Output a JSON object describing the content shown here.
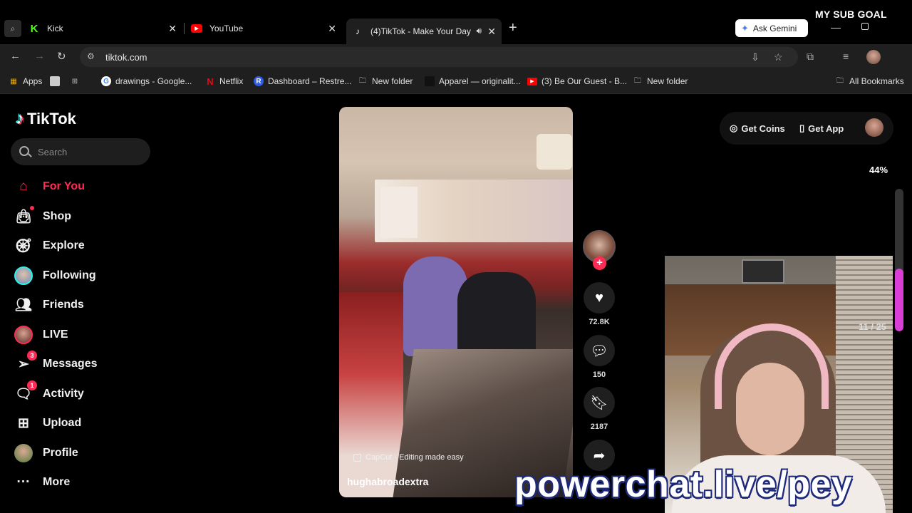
{
  "overlay": {
    "sub_goal": "MY SUB GOAL",
    "sub_goal_percent": "44%",
    "sub_goal_fraction": 0.44,
    "counter": "11 / 25",
    "powerchat": "powerchat.live/pey"
  },
  "browser": {
    "tabs": [
      {
        "label": "Kick",
        "icon": "kick-icon",
        "color": "#53fc18"
      },
      {
        "label": "YouTube",
        "icon": "youtube-icon",
        "color": "#ff0000"
      },
      {
        "label": "(4)TikTok - Make Your Day",
        "icon": "tiktok-icon",
        "active": true
      }
    ],
    "gemini_label": "Ask Gemini",
    "url": "tiktok.com",
    "bookmarks": [
      {
        "label": "Apps",
        "icon": "apps-grid-icon"
      },
      {
        "label": "drawings - Google...",
        "icon": "google-icon"
      },
      {
        "label": "Netflix",
        "icon": "netflix-icon"
      },
      {
        "label": "Dashboard – Restre...",
        "icon": "restream-icon"
      },
      {
        "label": "New folder",
        "icon": "folder-icon"
      },
      {
        "label": "Apparel — originalit...",
        "icon": "apparel-icon"
      },
      {
        "label": "(3) Be Our Guest - B...",
        "icon": "youtube-icon"
      },
      {
        "label": "New folder",
        "icon": "folder-icon"
      },
      {
        "label": "All Bookmarks",
        "icon": "folder-icon"
      }
    ]
  },
  "tiktok": {
    "logo": "TikTok",
    "search_placeholder": "Search",
    "nav": [
      {
        "label": "For You",
        "icon": "home-icon",
        "active": true
      },
      {
        "label": "Shop",
        "icon": "shop-bag-icon"
      },
      {
        "label": "Explore",
        "icon": "compass-icon"
      },
      {
        "label": "Following",
        "icon": "following-avatar-icon"
      },
      {
        "label": "Friends",
        "icon": "friends-icon"
      },
      {
        "label": "LIVE",
        "icon": "live-avatar-icon"
      },
      {
        "label": "Messages",
        "icon": "messages-icon",
        "badge": "3"
      },
      {
        "label": "Activity",
        "icon": "activity-icon",
        "badge": "1"
      },
      {
        "label": "Upload",
        "icon": "upload-icon"
      },
      {
        "label": "Profile",
        "icon": "profile-avatar-icon"
      },
      {
        "label": "More",
        "icon": "more-dots-icon"
      }
    ],
    "get_coins": "Get Coins",
    "get_app": "Get App",
    "video": {
      "capcut": "CapCut · Editing made easy",
      "author": "hughabroadextra",
      "likes": "72.8K",
      "comments": "150",
      "saves": "2187"
    },
    "accent": "#fe2c55"
  }
}
